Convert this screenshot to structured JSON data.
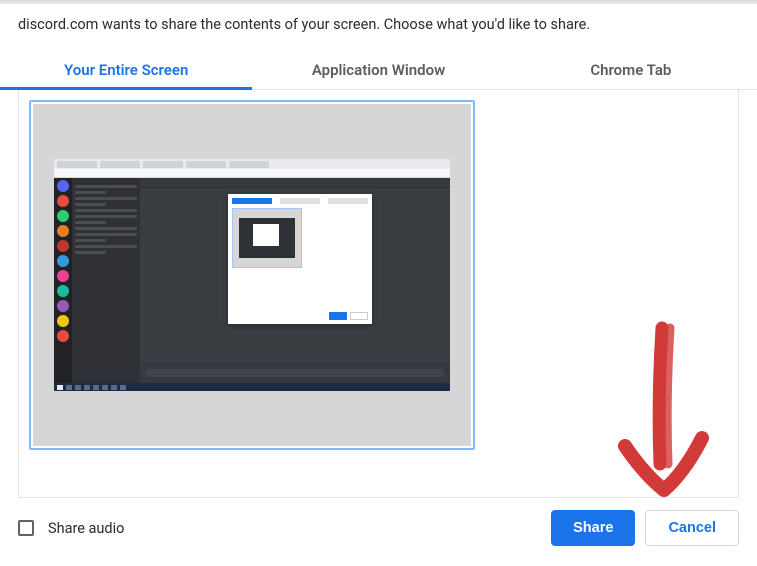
{
  "prompt": "discord.com wants to share the contents of your screen. Choose what you'd like to share.",
  "tabs": {
    "entire_screen": "Your Entire Screen",
    "app_window": "Application Window",
    "chrome_tab": "Chrome Tab"
  },
  "share_audio_label": "Share audio",
  "buttons": {
    "share": "Share",
    "cancel": "Cancel"
  },
  "annotation": {
    "type": "arrow",
    "color": "#d23a3a",
    "points_to": "share-button"
  }
}
